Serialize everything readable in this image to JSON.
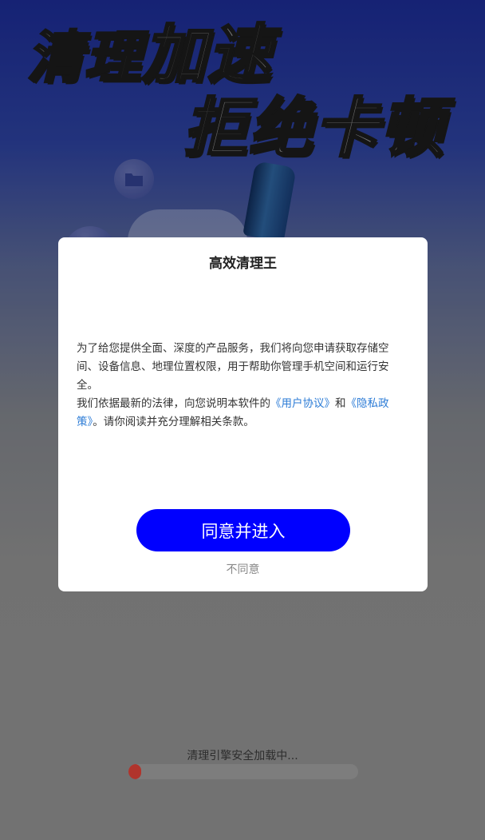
{
  "banner": {
    "line1_a": "清理",
    "line1_b": "加速",
    "line2": "拒绝卡顿"
  },
  "dialog": {
    "title": "高效清理王",
    "para1": "为了给您提供全面、深度的产品服务，我们将向您申请获取存储空间、设备信息、地理位置权限，用于帮助你管理手机空间和运行安全。",
    "para2_prefix": "我们依据最新的法律，向您说明本软件的",
    "user_agreement_link": "《用户协议》",
    "conjunction": "和",
    "privacy_policy_link": "《隐私政策》",
    "para2_suffix": "。请你阅读并充分理解相关条款。",
    "agree_button": "同意并进入",
    "disagree_button": "不同意"
  },
  "loading": {
    "text": "清理引擎安全加载中...",
    "progress": 0.05
  },
  "colors": {
    "accent_button": "#0000ff",
    "link": "#2b7bd6",
    "progress_fill": "#b0342c"
  }
}
